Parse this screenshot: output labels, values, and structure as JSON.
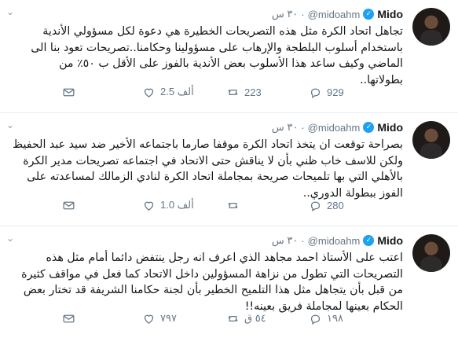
{
  "tweets": [
    {
      "name": "Mido",
      "handle": "@midoahm",
      "time": "٣٠ س",
      "text": "تجاهل اتحاد الكرة مثل هذه التصريحات الخطيرة هي دعوة لكل مسؤولي الأندية باستخدام أسلوب البلطجة والإرهاب على مسؤولينا وحكامنا..تصريحات تعود بنا الى الماضي وكيف ساعد هذا الأسلوب بعض الأندية بالفوز على الأقل ب ٥٠٪ من بطولاتها..",
      "replies": "929",
      "retweets": "223",
      "likes": "2.5 ألف"
    },
    {
      "name": "Mido",
      "handle": "@midoahm",
      "time": "٣٠ س",
      "text": "بصراحة توقعت ان يتخذ اتحاد الكرة موقفا صارما باجتماعه الأخير ضد سيد عبد الحفيظ ولكن للاسف خاب ظني بأن لا يناقش حتى الاتحاد في اجتماعه تصريحات مدير الكرة بالأهلي التي بها تلميحات صريحة بمجاملة اتحاد الكرة لنادي الزمالك لمساعدته على الفوز ببطولة الدوري..",
      "replies": "280",
      "retweets": "",
      "likes": "1.0 ألف"
    },
    {
      "name": "Mido",
      "handle": "@midoahm",
      "time": "٣٠ س",
      "text": "اعتب على الأستاذ احمد مجاهد الذي اعرف انه رجل ينتفض دائما أمام مثل هذه التصريحات التي تطول من نزاهة المسؤولين داخل الاتحاد كما فعل في مواقف كثيرة من قبل بأن يتجاهل مثل هذا التلميح الخطير بأن لجنة حكامنا الشريفة قد تختار بعض الحكام بعينها لمجاملة فريق بعينه!!",
      "replies": "١٩٨",
      "retweets": "٥٤ ق",
      "likes": "٧٩٧"
    }
  ]
}
